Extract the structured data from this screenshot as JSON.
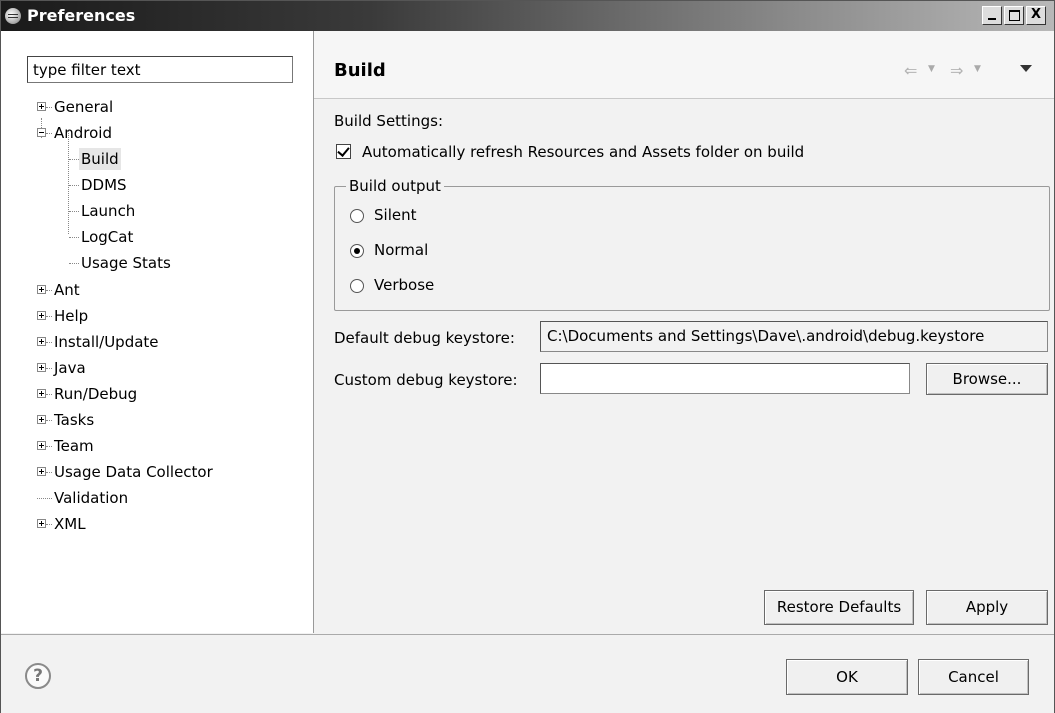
{
  "window": {
    "title": "Preferences",
    "minimize_glyph": "",
    "maximize_glyph": "",
    "close_glyph": "X"
  },
  "filter": {
    "value": "type filter text"
  },
  "tree": {
    "general": "General",
    "android": "Android",
    "build": "Build",
    "ddms": "DDMS",
    "launch": "Launch",
    "logcat": "LogCat",
    "usage_stats": "Usage Stats",
    "ant": "Ant",
    "help": "Help",
    "install_update": "Install/Update",
    "java": "Java",
    "run_debug": "Run/Debug",
    "tasks": "Tasks",
    "team": "Team",
    "usage_data_collector": "Usage Data Collector",
    "validation": "Validation",
    "xml": "XML"
  },
  "page": {
    "title": "Build",
    "nav": {
      "back_icon": "arrow-left",
      "forward_icon": "arrow-right",
      "menu_icon": "triangle-down"
    }
  },
  "settings": {
    "heading": "Build Settings:",
    "auto_refresh_label": "Automatically refresh Resources and Assets folder on build",
    "auto_refresh_checked": true,
    "output_group_title": "Build output",
    "output_options": [
      "Silent",
      "Normal",
      "Verbose"
    ],
    "output_selected": "Normal",
    "default_keystore_label": "Default debug keystore:",
    "default_keystore_value": "C:\\Documents and Settings\\Dave\\.android\\debug.keystore",
    "custom_keystore_label": "Custom debug keystore:",
    "custom_keystore_value": "",
    "browse_label": "Browse..."
  },
  "page_buttons": {
    "restore_defaults": "Restore Defaults",
    "apply": "Apply"
  },
  "dialog_buttons": {
    "ok": "OK",
    "cancel": "Cancel",
    "help_glyph": "?"
  }
}
